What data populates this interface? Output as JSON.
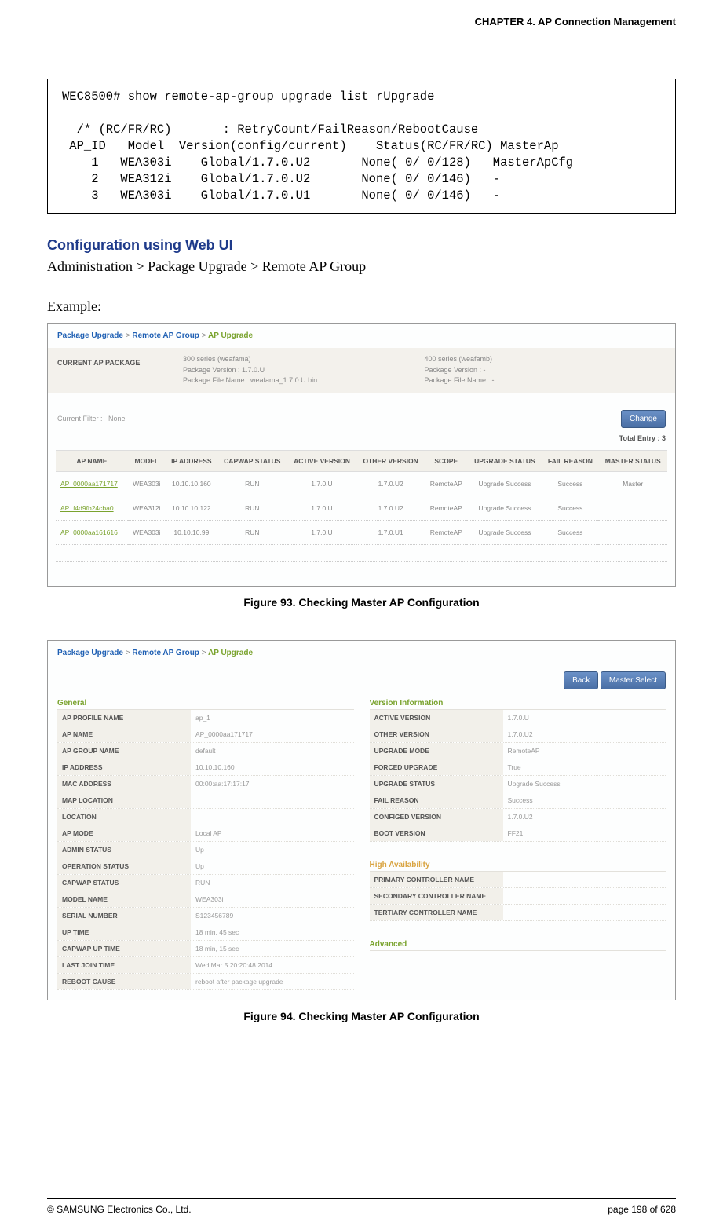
{
  "header": {
    "chapter": "CHAPTER 4. AP Connection Management"
  },
  "cli_block": "WEC8500# show remote-ap-group upgrade list rUpgrade\n\n  /* (RC/FR/RC)       : RetryCount/FailReason/RebootCause\n AP_ID   Model  Version(config/current)    Status(RC/FR/RC) MasterAp\n    1   WEA303i    Global/1.7.0.U2       None( 0/ 0/128)   MasterApCfg\n    2   WEA312i    Global/1.7.0.U2       None( 0/ 0/146)   -\n    3   WEA303i    Global/1.7.0.U1       None( 0/ 0/146)   -",
  "section": {
    "heading": "Configuration using Web UI",
    "path": "Administration > Package Upgrade > Remote AP Group",
    "example_label": "Example:"
  },
  "screenshot1": {
    "breadcrumb": {
      "p1": "Package Upgrade",
      "p2": "Remote AP Group",
      "p3": "AP Upgrade",
      "arrow": ">"
    },
    "current_pkg": {
      "label": "CURRENT AP PACKAGE",
      "s300": {
        "title": "300 series (weafama)",
        "ver": "Package Version : 1.7.0.U",
        "file": "Package File Name : weafama_1.7.0.U.bin"
      },
      "s400": {
        "title": "400 series (weafamb)",
        "ver": "Package Version : -",
        "file": "Package File Name : -"
      }
    },
    "filter": {
      "label": "Current Filter :",
      "value": "None",
      "btn": "Change"
    },
    "total": "Total Entry : 3",
    "columns": [
      "AP NAME",
      "MODEL",
      "IP ADDRESS",
      "CAPWAP STATUS",
      "ACTIVE VERSION",
      "OTHER VERSION",
      "SCOPE",
      "UPGRADE STATUS",
      "FAIL REASON",
      "MASTER STATUS"
    ],
    "rows": [
      {
        "ap": "AP_0000aa171717",
        "model": "WEA303i",
        "ip": "10.10.10.160",
        "capwap": "RUN",
        "active": "1.7.0.U",
        "other": "1.7.0.U2",
        "scope": "RemoteAP",
        "ustatus": "Upgrade Success",
        "fail": "Success",
        "master": "Master"
      },
      {
        "ap": "AP_f4d9fb24cba0",
        "model": "WEA312i",
        "ip": "10.10.10.122",
        "capwap": "RUN",
        "active": "1.7.0.U",
        "other": "1.7.0.U2",
        "scope": "RemoteAP",
        "ustatus": "Upgrade Success",
        "fail": "Success",
        "master": ""
      },
      {
        "ap": "AP_0000aa161616",
        "model": "WEA303i",
        "ip": "10.10.10.99",
        "capwap": "RUN",
        "active": "1.7.0.U",
        "other": "1.7.0.U1",
        "scope": "RemoteAP",
        "ustatus": "Upgrade Success",
        "fail": "Success",
        "master": ""
      }
    ]
  },
  "caption1": "Figure 93. Checking Master AP Configuration",
  "screenshot2": {
    "breadcrumb": {
      "p1": "Package Upgrade",
      "p2": "Remote AP Group",
      "p3": "AP Upgrade",
      "arrow": ">"
    },
    "buttons": {
      "back": "Back",
      "master": "Master Select"
    },
    "general_title": "General",
    "version_title": "Version Information",
    "ha_title": "High Availability",
    "adv_title": "Advanced",
    "general": [
      {
        "k": "AP PROFILE NAME",
        "v": "ap_1"
      },
      {
        "k": "AP NAME",
        "v": "AP_0000aa171717"
      },
      {
        "k": "AP GROUP NAME",
        "v": "default"
      },
      {
        "k": "IP ADDRESS",
        "v": "10.10.10.160"
      },
      {
        "k": "MAC ADDRESS",
        "v": "00:00:aa:17:17:17"
      },
      {
        "k": "MAP LOCATION",
        "v": ""
      },
      {
        "k": "LOCATION",
        "v": ""
      },
      {
        "k": "AP MODE",
        "v": "Local AP"
      },
      {
        "k": "ADMIN STATUS",
        "v": "Up"
      },
      {
        "k": "OPERATION STATUS",
        "v": "Up"
      },
      {
        "k": "CAPWAP STATUS",
        "v": "RUN"
      },
      {
        "k": "MODEL NAME",
        "v": "WEA303i"
      },
      {
        "k": "SERIAL NUMBER",
        "v": "S123456789"
      },
      {
        "k": "UP TIME",
        "v": "18 min, 45 sec"
      },
      {
        "k": "CAPWAP UP TIME",
        "v": "18 min, 15 sec"
      },
      {
        "k": "LAST JOIN TIME",
        "v": "Wed Mar 5 20:20:48 2014"
      },
      {
        "k": "REBOOT CAUSE",
        "v": "reboot after package upgrade"
      }
    ],
    "version": [
      {
        "k": "ACTIVE VERSION",
        "v": "1.7.0.U"
      },
      {
        "k": "OTHER VERSION",
        "v": "1.7.0.U2"
      },
      {
        "k": "UPGRADE MODE",
        "v": "RemoteAP"
      },
      {
        "k": "FORCED UPGRADE",
        "v": "True"
      },
      {
        "k": "UPGRADE STATUS",
        "v": "Upgrade Success"
      },
      {
        "k": "FAIL REASON",
        "v": "Success"
      },
      {
        "k": "CONFIGED VERSION",
        "v": "1.7.0.U2"
      },
      {
        "k": "BOOT VERSION",
        "v": "FF21"
      }
    ],
    "ha": [
      {
        "k": "PRIMARY CONTROLLER NAME",
        "v": ""
      },
      {
        "k": "SECONDARY CONTROLLER NAME",
        "v": ""
      },
      {
        "k": "TERTIARY CONTROLLER NAME",
        "v": ""
      }
    ]
  },
  "caption2": "Figure 94. Checking Master AP Configuration",
  "footer": {
    "copyright": "© SAMSUNG Electronics Co., Ltd.",
    "page": "page 198 of 628"
  }
}
